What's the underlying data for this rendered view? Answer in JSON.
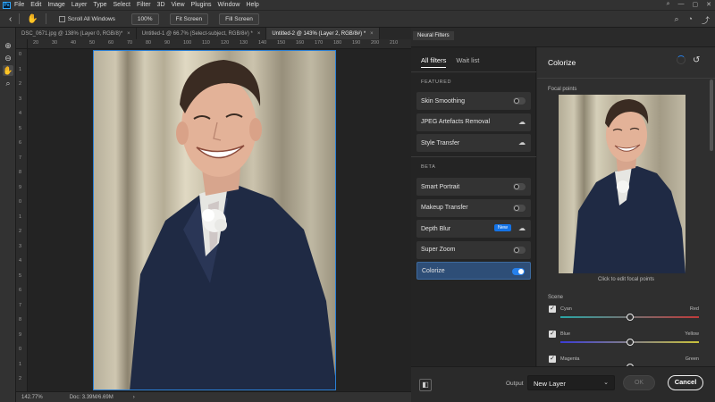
{
  "menu": {
    "logo": "Ps",
    "items": [
      "File",
      "Edit",
      "Image",
      "Layer",
      "Type",
      "Select",
      "Filter",
      "3D",
      "View",
      "Plugins",
      "Window",
      "Help"
    ]
  },
  "options_bar": {
    "scroll_all_label": "Scroll All Windows",
    "zoom_button": "100%",
    "fit_button": "Fit Screen",
    "fill_button": "Fill Screen"
  },
  "tabs": [
    {
      "label": "DSC_0671.jpg @ 138% (Layer 0, RGB/8)*",
      "close": "×"
    },
    {
      "label": "Untitled-1 @ 66.7% (Select-subject, RGB/8#) *",
      "close": "×"
    },
    {
      "label": "Untitled-2 @ 143% (Layer 2, RGB/8#) *",
      "close": "×"
    }
  ],
  "ruler": {
    "top": [
      "20",
      "30",
      "40",
      "50",
      "60",
      "70",
      "80",
      "90",
      "100",
      "110",
      "120",
      "130",
      "140",
      "150",
      "160",
      "170",
      "180",
      "190",
      "200",
      "210"
    ],
    "left": [
      "0",
      "1",
      "2",
      "3",
      "4",
      "5",
      "6",
      "7",
      "8",
      "9",
      "0",
      "1",
      "2",
      "3",
      "4",
      "5",
      "6",
      "7",
      "8",
      "9",
      "0",
      "1",
      "2"
    ]
  },
  "status": {
    "zoom": "142.77%",
    "doc": "Doc: 3.39M/6.69M",
    "arrow": "›"
  },
  "neural_filters": {
    "panel_title": "Neural Filters",
    "tab_all": "All filters",
    "tab_waitlist": "Wait list",
    "featured_title": "FEATURED",
    "beta_title": "BETA",
    "featured": [
      {
        "label": "Skin Smoothing",
        "control": "toggle",
        "on": false
      },
      {
        "label": "JPEG Artefacts Removal",
        "control": "cloud",
        "on": false
      },
      {
        "label": "Style Transfer",
        "control": "cloud",
        "on": false
      }
    ],
    "beta": [
      {
        "label": "Smart Portrait",
        "control": "toggle",
        "on": false
      },
      {
        "label": "Makeup Transfer",
        "control": "toggle",
        "on": false
      },
      {
        "label": "Depth Blur",
        "control": "cloud",
        "badge": "New",
        "on": false
      },
      {
        "label": "Super Zoom",
        "control": "toggle",
        "on": false
      },
      {
        "label": "Colorize",
        "control": "toggle",
        "on": true,
        "selected": true
      }
    ],
    "detail": {
      "title": "Colorize",
      "focal_label": "Focal points",
      "focal_hint": "Click to edit focal points",
      "scene_label": "Scene",
      "sliders": [
        {
          "left": "Cyan",
          "right": "Red",
          "value": 0.5,
          "from": "#29a6a6",
          "to": "#c03a3a"
        },
        {
          "left": "Blue",
          "right": "Yellow",
          "value": 0.5,
          "from": "#3b3bd6",
          "to": "#c9c23a"
        },
        {
          "left": "Magenta",
          "right": "Green",
          "value": 0.5,
          "from": "#c13bbf",
          "to": "#3bbf4a"
        }
      ]
    },
    "output_label": "Output",
    "output_value": "New Layer",
    "ok_label": "OK",
    "cancel_label": "Cancel"
  },
  "colors": {
    "accent": "#2680eb",
    "selection": "#2e4e77",
    "canvas_border": "#2a7fd5"
  }
}
